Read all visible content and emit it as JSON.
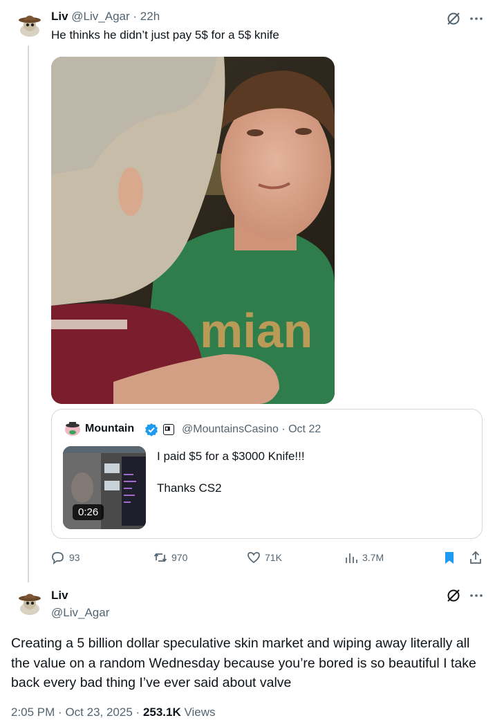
{
  "tweet1": {
    "name": "Liv",
    "handle": "@Liv_Agar",
    "time": "22h",
    "text": "He thinks he didn’t just pay 5$ for a 5$ knife",
    "photo_shirt_text": "mian"
  },
  "quote": {
    "name": "Mountain",
    "handle": "@MountainsCasino",
    "date": "Oct 22",
    "line1": "I paid $5 for a $3000 Knife!!!",
    "line2": "Thanks CS2",
    "video_duration": "0:26"
  },
  "actions": {
    "replies": "93",
    "retweets": "970",
    "likes": "71K",
    "views": "3.7M"
  },
  "tweet2": {
    "name": "Liv",
    "handle": "@Liv_Agar",
    "text": "Creating a 5 billion dollar speculative skin market and wiping away literally all the value on a random Wednesday because you’re bored is so beautiful I take back every bad thing I’ve ever said about valve",
    "time": "2:05 PM",
    "date": "Oct 23, 2025",
    "views_count": "253.1K",
    "views_label": "Views"
  },
  "colors": {
    "accent": "#1d9bf0",
    "muted": "#536471",
    "border": "#cfd9de"
  },
  "icons": [
    "grok-icon",
    "more-icon",
    "verified-icon",
    "affiliate-icon",
    "reply-icon",
    "retweet-icon",
    "like-icon",
    "views-icon",
    "bookmark-icon",
    "share-icon"
  ]
}
